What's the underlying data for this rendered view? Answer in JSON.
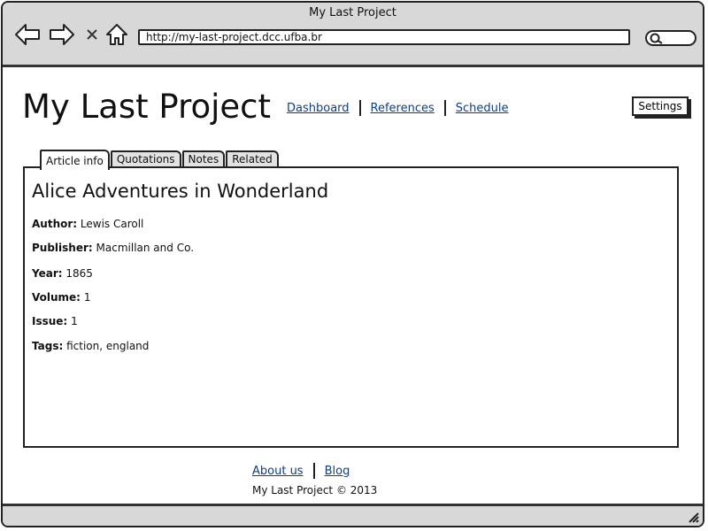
{
  "window": {
    "title": "My Last Project"
  },
  "browser": {
    "address": "http://my-last-project.dcc.ufba.br",
    "icons": [
      "back-arrow-icon",
      "forward-arrow-icon",
      "close-icon",
      "home-icon",
      "search-icon",
      "resize-grip-icon"
    ]
  },
  "header": {
    "brand": "My Last Project",
    "nav": [
      "Dashboard",
      "References",
      "Schedule"
    ],
    "settings_label": "Settings"
  },
  "tabs": [
    {
      "label": "Article info",
      "active": true
    },
    {
      "label": "Quotations",
      "active": false
    },
    {
      "label": "Notes",
      "active": false
    },
    {
      "label": "Related",
      "active": false
    }
  ],
  "article": {
    "title": "Alice Adventures in Wonderland",
    "fields": [
      {
        "label": "Author:",
        "value": "Lewis Caroll"
      },
      {
        "label": "Publisher:",
        "value": "Macmillan and Co."
      },
      {
        "label": "Year:",
        "value": "1865"
      },
      {
        "label": "Volume:",
        "value": "1"
      },
      {
        "label": "Issue:",
        "value": "1"
      },
      {
        "label": "Tags:",
        "value": "fiction, england"
      }
    ]
  },
  "footer": {
    "links": [
      "About us",
      "Blog"
    ],
    "copyright": "My Last Project © 2013"
  },
  "colors": {
    "link": "#0b3e88",
    "chrome": "#d8d8d8",
    "border": "#222222"
  }
}
